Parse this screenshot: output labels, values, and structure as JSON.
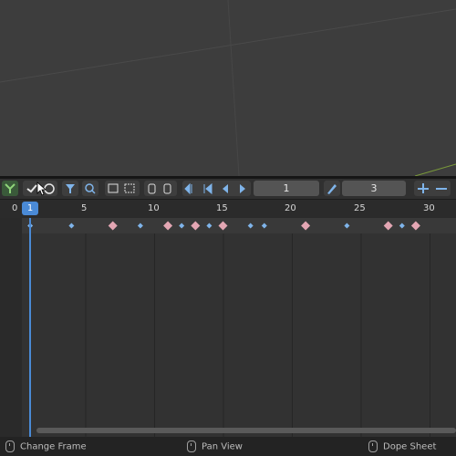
{
  "toolbar": {
    "current_frame": "1",
    "keyframe_step": "3"
  },
  "timeline": {
    "current_frame_badge": "1",
    "ruler_labels": [
      "0",
      "5",
      "10",
      "15",
      "20",
      "25",
      "30"
    ],
    "keyframes_summary": [
      1,
      4,
      7,
      9,
      11,
      12,
      13,
      14,
      15,
      17,
      18,
      21,
      24,
      27,
      28,
      29
    ],
    "keyframes_pink": [
      7,
      11,
      13,
      15,
      21,
      27,
      29
    ]
  },
  "status": {
    "left": "Change Frame",
    "middle": "Pan View",
    "right": "Dope Sheet"
  },
  "colors": {
    "accent": "#4a8ad6",
    "keyframe_blue": "#7fb4ea",
    "keyframe_pink": "#e3a6b3"
  }
}
